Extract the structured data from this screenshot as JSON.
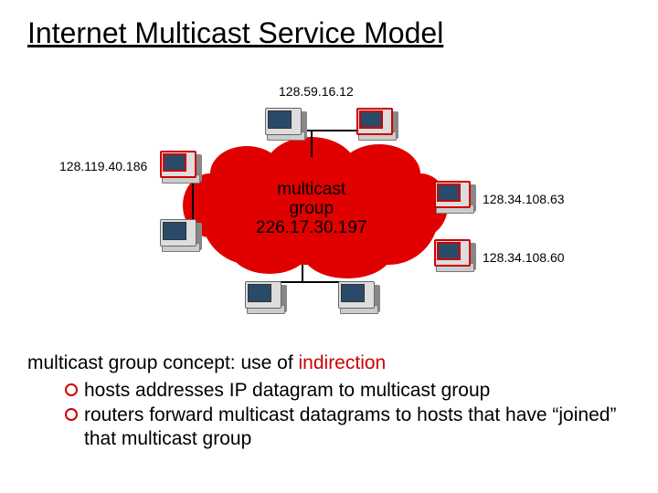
{
  "title": "Internet Multicast Service Model",
  "ips": {
    "top": "128.59.16.12",
    "left": "128.119.40.186",
    "right1": "128.34.108.63",
    "right2": "128.34.108.60"
  },
  "cloud": {
    "line1": "multicast",
    "line2": "group",
    "line3": "226.17.30.197"
  },
  "desc": {
    "lead": "multicast group concept: use of ",
    "hl": "indirection",
    "b1": "hosts addresses IP datagram to multicast group",
    "b2": "routers forward multicast datagrams to hosts that have “joined” that multicast group"
  }
}
